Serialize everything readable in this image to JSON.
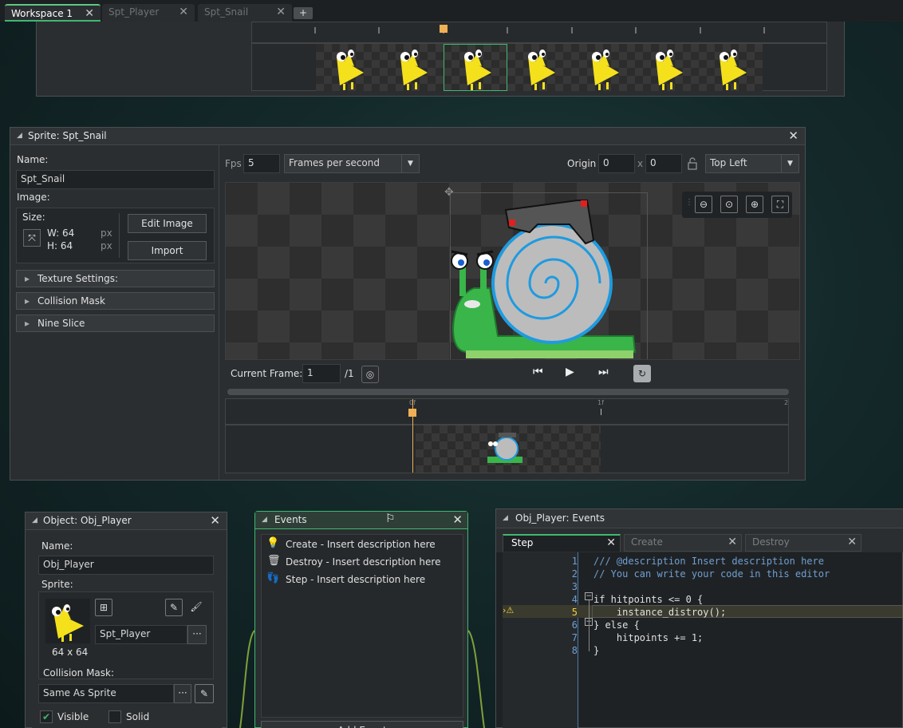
{
  "tabs": [
    {
      "label": "Workspace 1",
      "active": true
    },
    {
      "label": "Spt_Player",
      "active": false
    },
    {
      "label": "Spt_Snail",
      "active": false
    }
  ],
  "add_tab_label": "+",
  "sprite_editor": {
    "title": "Sprite: Spt_Snail",
    "name_label": "Name:",
    "name_value": "Spt_Snail",
    "image_label": "Image:",
    "size_label": "Size:",
    "width": "W: 64",
    "height": "H: 64",
    "unit": "px",
    "edit_image": "Edit Image",
    "import": "Import",
    "sections": [
      "Texture Settings:",
      "Collision Mask",
      "Nine Slice"
    ],
    "fps_label": "Fps",
    "fps_value": "5",
    "fps_mode": "Frames per second",
    "origin_label": "Origin",
    "origin_x": "0",
    "origin_y": "0",
    "origin_sep": "x",
    "origin_preset": "Top Left",
    "current_frame_label": "Current Frame:",
    "current_frame_value": "1",
    "frame_total": "/1",
    "timeline_ticks": [
      "0f",
      "1f",
      "2"
    ]
  },
  "object_editor": {
    "title": "Object: Obj_Player",
    "name_label": "Name:",
    "name_value": "Obj_Player",
    "sprite_label": "Sprite:",
    "sprite_value": "Spt_Player",
    "sprite_size": "64 x 64",
    "collision_label": "Collision Mask:",
    "collision_value": "Same As Sprite",
    "visible_label": "Visible",
    "solid_label": "Solid",
    "visible_checked": true,
    "solid_checked": false
  },
  "events_panel": {
    "title": "Events",
    "events": [
      {
        "icon": "lightbulb-icon",
        "label": "Create - Insert description here"
      },
      {
        "icon": "trash-icon",
        "label": "Destroy - Insert description here"
      },
      {
        "icon": "footsteps-icon",
        "label": "Step - Insert description here"
      }
    ],
    "add_event": "Add Event"
  },
  "code_editor": {
    "title": "Obj_Player: Events",
    "tabs": [
      "Step",
      "Create",
      "Destroy"
    ],
    "lines": [
      {
        "n": "1",
        "text": "/// @description Insert description here"
      },
      {
        "n": "2",
        "text": "// You can write your code in this editor"
      },
      {
        "n": "3",
        "text": ""
      },
      {
        "n": "4",
        "text": "if hitpoints <= 0 {"
      },
      {
        "n": "5",
        "text": "    instance_distroy();"
      },
      {
        "n": "6",
        "text": "} else {"
      },
      {
        "n": "7",
        "text": "    hitpoints += 1;"
      },
      {
        "n": "8",
        "text": "}"
      }
    ]
  },
  "colors": {
    "accent_green": "#3fb870",
    "accent_orange": "#f0b055",
    "code_blue": "#6f9fd4",
    "code_number": "#e07a5f"
  }
}
